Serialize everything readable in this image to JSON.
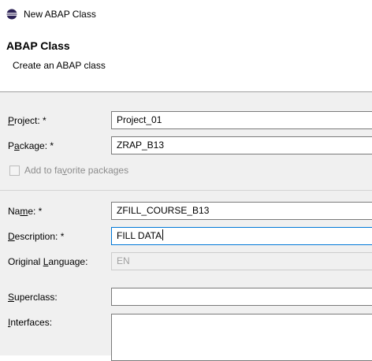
{
  "window": {
    "title": "New ABAP Class"
  },
  "header": {
    "title": "ABAP Class",
    "subtitle": "Create an ABAP class"
  },
  "form": {
    "project": {
      "label_pre": "",
      "label_key": "P",
      "label_post": "roject: *",
      "value": "Project_01"
    },
    "package": {
      "label_pre": "P",
      "label_key": "a",
      "label_post": "ckage: *",
      "value": "ZRAP_B13"
    },
    "favorite": {
      "label_pre": "Add to fa",
      "label_key": "v",
      "label_post": "orite packages",
      "checked": false
    },
    "name": {
      "label_pre": "Na",
      "label_key": "m",
      "label_post": "e: *",
      "value": "ZFILL_COURSE_B13"
    },
    "description": {
      "label_pre": "",
      "label_key": "D",
      "label_post": "escription: *",
      "value": "FILL DATA"
    },
    "language": {
      "label_pre": "Original ",
      "label_key": "L",
      "label_post": "anguage:",
      "value": "EN"
    },
    "superclass": {
      "label_pre": "",
      "label_key": "S",
      "label_post": "uperclass:",
      "value": ""
    },
    "interfaces": {
      "label_pre": "",
      "label_key": "I",
      "label_post": "nterfaces:"
    }
  },
  "colors": {
    "focus_border": "#0078d7",
    "form_background": "#f0f0f0",
    "disabled_text": "#a0a0a0"
  },
  "icons": {
    "window": "eclipse-icon"
  }
}
